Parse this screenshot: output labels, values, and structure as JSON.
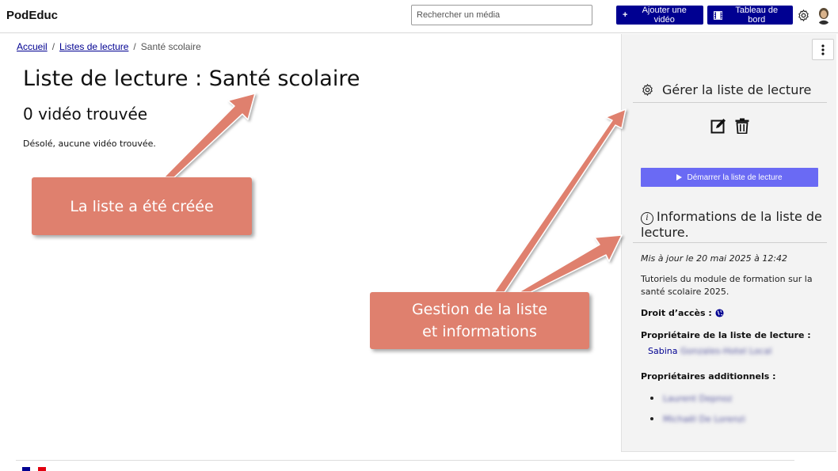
{
  "header": {
    "brand": "PodEduc",
    "search_placeholder": "Rechercher un média",
    "add_video_label": "Ajouter une vidéo",
    "dashboard_label": "Tableau de bord"
  },
  "breadcrumb": {
    "home": "Accueil",
    "separator": "/",
    "playlists": "Listes de lecture",
    "current": "Santé scolaire"
  },
  "main": {
    "title": "Liste de lecture : Santé scolaire",
    "count": "0 vidéo trouvée",
    "empty_message": "Désolé, aucune vidéo trouvée."
  },
  "sidebar": {
    "manage_title": "Gérer la liste de lecture",
    "start_label": "Démarrer la liste de lecture",
    "info_title": "Informations de la liste de lecture.",
    "updated": "Mis à jour le 20 mai 2025 à 12:42",
    "description": "Tutoriels du module de formation sur la santé scolaire 2025.",
    "access_label": "Droit d’accès :",
    "owner_label": "Propriétaire de la liste de lecture :",
    "owner_first": "Sabina",
    "owner_rest_blurred": "Gonzales-Hotel Local",
    "additional_label": "Propriétaires additionnels :",
    "additional_owners": [
      "Laurent Depnoz",
      "Michaël De Lorenzi"
    ]
  },
  "annotations": {
    "callout_created": "La liste a été créée",
    "callout_manage_line1": "Gestion de la liste",
    "callout_manage_line2": "et informations"
  },
  "colors": {
    "primary": "#000091",
    "start_button": "#6a6af4",
    "callout": "#df806e",
    "sidebar_bg": "#f3f3f3"
  }
}
